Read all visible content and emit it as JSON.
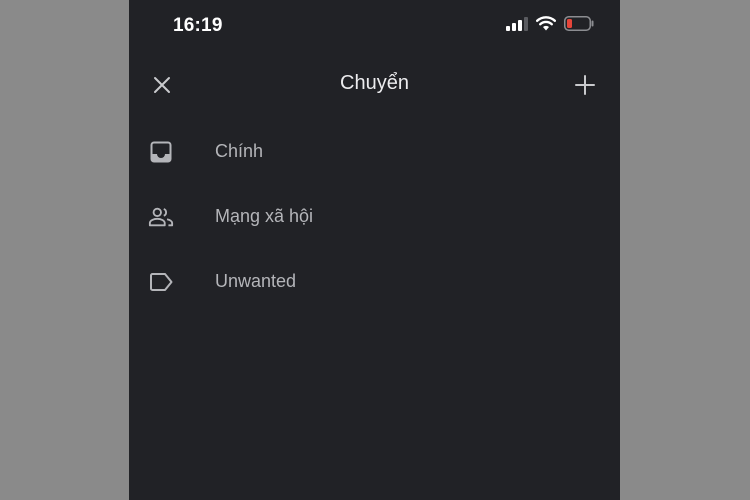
{
  "status_bar": {
    "time": "16:19",
    "icons": [
      "signal-icon",
      "wifi-icon",
      "battery-icon"
    ],
    "battery_color": "#e5453a"
  },
  "header": {
    "title": "Chuyển",
    "close_icon": "close-icon",
    "add_icon": "plus-icon"
  },
  "labels": [
    {
      "icon": "inbox-icon",
      "label": "Chính"
    },
    {
      "icon": "people-icon",
      "label": "Mạng xã hội"
    },
    {
      "icon": "label-tag-icon",
      "label": "Unwanted"
    }
  ],
  "colors": {
    "background": "#212226",
    "side_margin": "#8a8a8a",
    "title_text": "#ececee",
    "item_text": "#b4b5b9",
    "icon": "#b4b5b9"
  }
}
